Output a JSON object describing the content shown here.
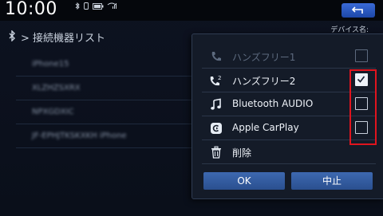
{
  "status": {
    "clock": "10:00",
    "icons": [
      "bluetooth-icon",
      "phone-icon",
      "battery-icon",
      "signal-icon"
    ]
  },
  "header": {
    "breadcrumb": "> 接続機器リスト",
    "device_name_label": "デバイス名:"
  },
  "device_list": [
    "iPhone15",
    "XLZHZSXRX",
    "NPXGDXIC",
    "JF-EPHJTKSKXKH iPhone"
  ],
  "popup": {
    "items": [
      {
        "icon": "phone-icon",
        "label": "ハンズフリー1",
        "disabled": true,
        "checkbox": true,
        "checked": false
      },
      {
        "icon": "phone-2-icon",
        "label": "ハンズフリー2",
        "disabled": false,
        "checkbox": true,
        "checked": true
      },
      {
        "icon": "music-note-icon",
        "label": "Bluetooth AUDIO",
        "disabled": false,
        "checkbox": true,
        "checked": false
      },
      {
        "icon": "carplay-icon",
        "label": "Apple CarPlay",
        "disabled": false,
        "checkbox": true,
        "checked": false
      },
      {
        "icon": "trash-icon",
        "label": "削除",
        "disabled": false,
        "checkbox": false,
        "checked": false
      }
    ],
    "ok_label": "OK",
    "cancel_label": "中止",
    "highlight_color": "#e0141e"
  }
}
